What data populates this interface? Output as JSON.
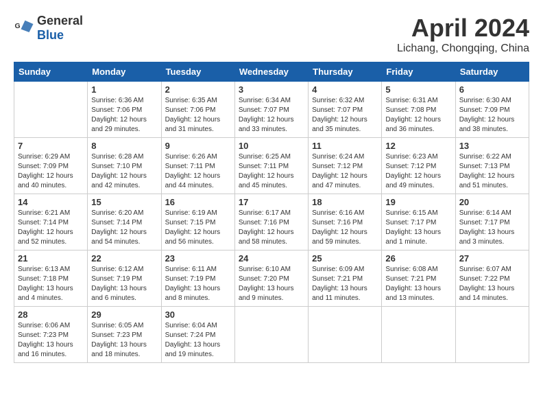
{
  "header": {
    "logo_line1": "General",
    "logo_line2": "Blue",
    "month_year": "April 2024",
    "location": "Lichang, Chongqing, China"
  },
  "days_of_week": [
    "Sunday",
    "Monday",
    "Tuesday",
    "Wednesday",
    "Thursday",
    "Friday",
    "Saturday"
  ],
  "weeks": [
    [
      {
        "day": "",
        "info": ""
      },
      {
        "day": "1",
        "info": "Sunrise: 6:36 AM\nSunset: 7:06 PM\nDaylight: 12 hours\nand 29 minutes."
      },
      {
        "day": "2",
        "info": "Sunrise: 6:35 AM\nSunset: 7:06 PM\nDaylight: 12 hours\nand 31 minutes."
      },
      {
        "day": "3",
        "info": "Sunrise: 6:34 AM\nSunset: 7:07 PM\nDaylight: 12 hours\nand 33 minutes."
      },
      {
        "day": "4",
        "info": "Sunrise: 6:32 AM\nSunset: 7:07 PM\nDaylight: 12 hours\nand 35 minutes."
      },
      {
        "day": "5",
        "info": "Sunrise: 6:31 AM\nSunset: 7:08 PM\nDaylight: 12 hours\nand 36 minutes."
      },
      {
        "day": "6",
        "info": "Sunrise: 6:30 AM\nSunset: 7:09 PM\nDaylight: 12 hours\nand 38 minutes."
      }
    ],
    [
      {
        "day": "7",
        "info": "Sunrise: 6:29 AM\nSunset: 7:09 PM\nDaylight: 12 hours\nand 40 minutes."
      },
      {
        "day": "8",
        "info": "Sunrise: 6:28 AM\nSunset: 7:10 PM\nDaylight: 12 hours\nand 42 minutes."
      },
      {
        "day": "9",
        "info": "Sunrise: 6:26 AM\nSunset: 7:11 PM\nDaylight: 12 hours\nand 44 minutes."
      },
      {
        "day": "10",
        "info": "Sunrise: 6:25 AM\nSunset: 7:11 PM\nDaylight: 12 hours\nand 45 minutes."
      },
      {
        "day": "11",
        "info": "Sunrise: 6:24 AM\nSunset: 7:12 PM\nDaylight: 12 hours\nand 47 minutes."
      },
      {
        "day": "12",
        "info": "Sunrise: 6:23 AM\nSunset: 7:12 PM\nDaylight: 12 hours\nand 49 minutes."
      },
      {
        "day": "13",
        "info": "Sunrise: 6:22 AM\nSunset: 7:13 PM\nDaylight: 12 hours\nand 51 minutes."
      }
    ],
    [
      {
        "day": "14",
        "info": "Sunrise: 6:21 AM\nSunset: 7:14 PM\nDaylight: 12 hours\nand 52 minutes."
      },
      {
        "day": "15",
        "info": "Sunrise: 6:20 AM\nSunset: 7:14 PM\nDaylight: 12 hours\nand 54 minutes."
      },
      {
        "day": "16",
        "info": "Sunrise: 6:19 AM\nSunset: 7:15 PM\nDaylight: 12 hours\nand 56 minutes."
      },
      {
        "day": "17",
        "info": "Sunrise: 6:17 AM\nSunset: 7:16 PM\nDaylight: 12 hours\nand 58 minutes."
      },
      {
        "day": "18",
        "info": "Sunrise: 6:16 AM\nSunset: 7:16 PM\nDaylight: 12 hours\nand 59 minutes."
      },
      {
        "day": "19",
        "info": "Sunrise: 6:15 AM\nSunset: 7:17 PM\nDaylight: 13 hours\nand 1 minute."
      },
      {
        "day": "20",
        "info": "Sunrise: 6:14 AM\nSunset: 7:17 PM\nDaylight: 13 hours\nand 3 minutes."
      }
    ],
    [
      {
        "day": "21",
        "info": "Sunrise: 6:13 AM\nSunset: 7:18 PM\nDaylight: 13 hours\nand 4 minutes."
      },
      {
        "day": "22",
        "info": "Sunrise: 6:12 AM\nSunset: 7:19 PM\nDaylight: 13 hours\nand 6 minutes."
      },
      {
        "day": "23",
        "info": "Sunrise: 6:11 AM\nSunset: 7:19 PM\nDaylight: 13 hours\nand 8 minutes."
      },
      {
        "day": "24",
        "info": "Sunrise: 6:10 AM\nSunset: 7:20 PM\nDaylight: 13 hours\nand 9 minutes."
      },
      {
        "day": "25",
        "info": "Sunrise: 6:09 AM\nSunset: 7:21 PM\nDaylight: 13 hours\nand 11 minutes."
      },
      {
        "day": "26",
        "info": "Sunrise: 6:08 AM\nSunset: 7:21 PM\nDaylight: 13 hours\nand 13 minutes."
      },
      {
        "day": "27",
        "info": "Sunrise: 6:07 AM\nSunset: 7:22 PM\nDaylight: 13 hours\nand 14 minutes."
      }
    ],
    [
      {
        "day": "28",
        "info": "Sunrise: 6:06 AM\nSunset: 7:23 PM\nDaylight: 13 hours\nand 16 minutes."
      },
      {
        "day": "29",
        "info": "Sunrise: 6:05 AM\nSunset: 7:23 PM\nDaylight: 13 hours\nand 18 minutes."
      },
      {
        "day": "30",
        "info": "Sunrise: 6:04 AM\nSunset: 7:24 PM\nDaylight: 13 hours\nand 19 minutes."
      },
      {
        "day": "",
        "info": ""
      },
      {
        "day": "",
        "info": ""
      },
      {
        "day": "",
        "info": ""
      },
      {
        "day": "",
        "info": ""
      }
    ]
  ]
}
